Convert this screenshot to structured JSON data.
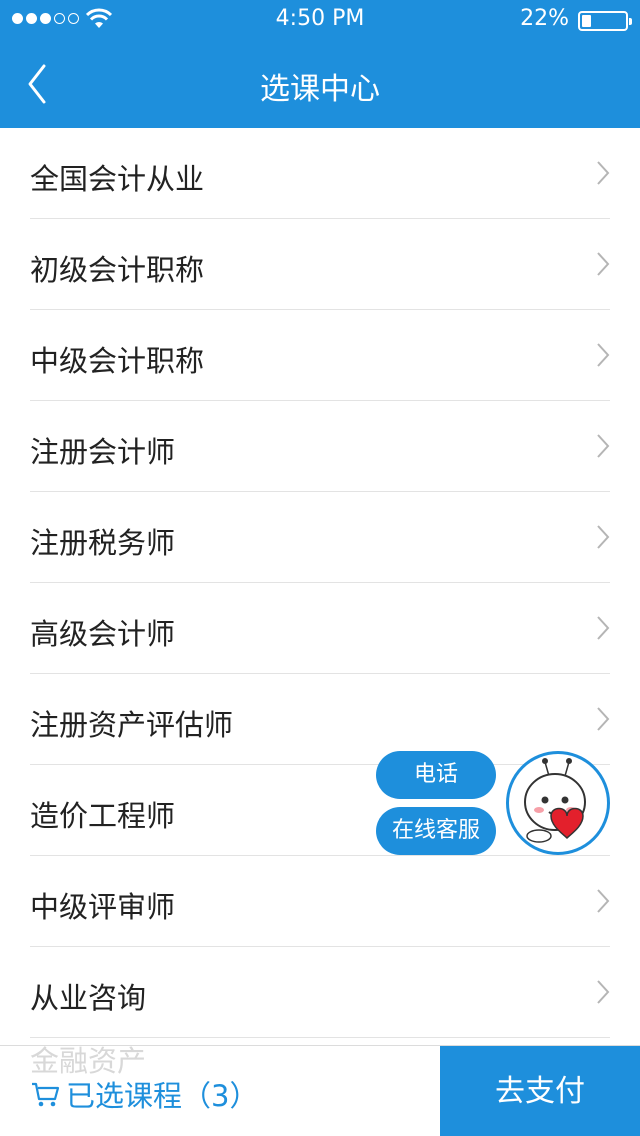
{
  "status_bar": {
    "time": "4:50 PM",
    "battery_text": "22%",
    "battery_level": 0.22,
    "signal_bars_filled": 3,
    "signal_bars_total": 5
  },
  "navbar": {
    "title": "选课中心",
    "back_icon": "chevron-left-icon"
  },
  "list": {
    "items": [
      {
        "label": "全国会计从业"
      },
      {
        "label": "初级会计职称"
      },
      {
        "label": "中级会计职称"
      },
      {
        "label": "注册会计师"
      },
      {
        "label": "注册税务师"
      },
      {
        "label": "高级会计师"
      },
      {
        "label": "注册资产评估师"
      },
      {
        "label": "造价工程师"
      },
      {
        "label": "中级评审师"
      },
      {
        "label": "从业咨询"
      }
    ],
    "peek_label": "金融资产"
  },
  "floating": {
    "phone_label": "电话",
    "chat_label": "在线客服"
  },
  "bottom_bar": {
    "cart_label": "已选课程（3）",
    "pay_label": "去支付"
  },
  "colors": {
    "accent": "#1e8fdc",
    "text": "#222222",
    "divider": "#e3e3e3"
  }
}
